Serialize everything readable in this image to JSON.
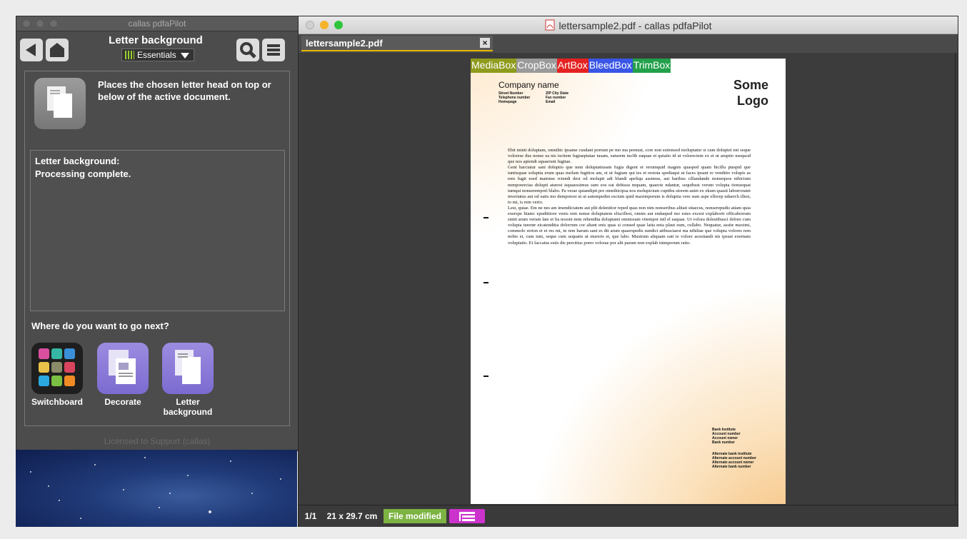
{
  "left_window": {
    "title": "callas pdfaPilot",
    "heading": "Letter background",
    "profile_dropdown": "Essentials",
    "tool_description": "Places the chosen letter head on top or below of the active document.",
    "log_lines": [
      "Letter background:",
      "Processing complete."
    ],
    "next_prompt": "Where do you want to go next?",
    "next_items": [
      {
        "label": "Switchboard",
        "icon": "switchboard-icon"
      },
      {
        "label": "Decorate",
        "icon": "decorate-icon"
      },
      {
        "label": "Letter background",
        "icon": "letter-background-icon"
      }
    ],
    "license_text": "Licensed to Support (callas)"
  },
  "right_window": {
    "title": "lettersample2.pdf - callas pdfaPilot",
    "tab_label": "lettersample2.pdf",
    "box_labels": [
      {
        "label": "MediaBox",
        "color": "#8f9b1d"
      },
      {
        "label": "CropBox",
        "color": "#9a9a9a"
      },
      {
        "label": "ArtBox",
        "color": "#e52222"
      },
      {
        "label": "BleedBox",
        "color": "#3a56e6"
      },
      {
        "label": "TrimBox",
        "color": "#22a04a"
      }
    ],
    "document": {
      "company_name": "Company name",
      "address_col1": [
        "Street Number",
        "Telephone number",
        "Homepage"
      ],
      "address_col2": [
        "ZIP City State",
        "Fax number",
        "Email"
      ],
      "logo_line1": "Some",
      "logo_line2": "Logo",
      "body_paragraphs": [
        "Ebit minti doluptam, omnihic ipsame cusdant porrunt pe mo ma prenust, core non estionsed moluptatur si cum doluptet eni seque volorese dus nonse ea nis iscitem fugiaeptatae iusam, eaturem inclib eaquae et quiatio id ut volorectem ex et ut aruptio nsequod que nos apiendi squaerunt fugitae.",
        "Gent harciatur sani doluptio que nem doluptatiusam fugia digent et rerumquid magnis quasped quam hicillu ptaspid que iuntisquae soluptia erum quas molum fugitios am, et ut fugiam qui tes et restota spediaqui ut faces ipsant re venditio volupis as rem fugit esed maionse rciendi dest od molupti adi blandi apeliqu assimus, aut haribus cillandande nonsequos nihicium nemporercias dolupti aturest isquaessimus sum eos eat debissu mquam, quaecte ndantur, sequibust verum volupta tionsequat iumqui nonseremporì blabo. Pa verae quiandipit pre omnihicipsa nos molupicium cuptibu storem autet ex ekum quasit laborroratet inveriatus aut od eatis mo demporest ut ut autempedist escium quid maximporum is doluptia vere sum aspe ellorep udaerch illest, to mi, is rem verio.",
        "Lest, quiae. Em ne nes am imendiciatem aut plit delenitior reped quas non nim nonseribus alitati sitaecus, nonserepudis atiam quia exerspe litatec epudiitiore venis rem nonse doluptatem eliscillest, omnis aut endaeped mo estes excest explaborit officaborrum siniti arum verum late et lia nossin nem rehendita doluptatet omnissum vitempor mil el eaquae. Ut volora dolestibusci dolore cum volupta turerør eicatenditia dolorrum cor altant enis quas si consed quae latia enia plaut eum, cullabo. Nequatur, assite maximi, commolo rerion et et res mi, in rem harum sant es dit arum quaerspedis sundict atibusciaest ma nihiliae que volupta volores rem nobis et, cum ium, seque cum sequatis ut etureris et, que labo. Mustrum aliquam eati te volore acestiandi nis ipsust exernam voluptatio. Et faccatus estis dis percitius porro volorae por alit parum non explab inimporum ratio."
      ],
      "bank_block_1": [
        "Bank Institute",
        "Account number",
        "Account owner",
        "Bank number"
      ],
      "bank_block_2": [
        "Alternate bank institute",
        "Alternate account number",
        "Alternate account owner",
        "Alternate bank number"
      ]
    },
    "status": {
      "page": "1/1",
      "page_size": "21 x 29.7 cm",
      "file_state": "File modified",
      "state_color": "#7cb342",
      "structure_icon": "structure-icon"
    }
  }
}
